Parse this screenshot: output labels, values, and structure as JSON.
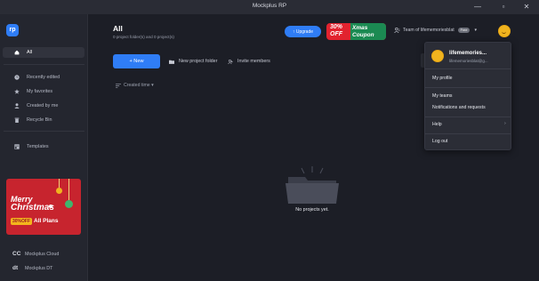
{
  "window": {
    "title": "Mockplus RP",
    "minimize": "—",
    "maximize": "▫",
    "close": "✕"
  },
  "sidebar": {
    "logo": "rp",
    "items": [
      {
        "label": "All",
        "icon": "home-icon",
        "active": true
      },
      {
        "label": "Recently edited",
        "icon": "clock-icon"
      },
      {
        "label": "My favorites",
        "icon": "star-icon"
      },
      {
        "label": "Created by me",
        "icon": "user-icon"
      },
      {
        "label": "Recycle Bin",
        "icon": "trash-icon"
      },
      {
        "label": "Templates",
        "icon": "template-icon"
      }
    ],
    "promo": {
      "line1": "Merry",
      "line2": "Christmas",
      "off": "30%OFF",
      "plans": "All Plans"
    },
    "footer": [
      {
        "mark": "CC",
        "label": "Mockplus Cloud"
      },
      {
        "mark": "dt",
        "label": "Mockplus DT"
      }
    ]
  },
  "header": {
    "title": "All",
    "subtitle": "0 project folder(s) and 0 project(s)",
    "upgrade_label": "↑ Upgrade",
    "coupon": {
      "left": "30%\nOFF",
      "right": "Xmas\nCoupon"
    },
    "team_label": "Team of lifememoriesblat",
    "team_badge": "Free",
    "team_chevron": "▾"
  },
  "toolbar": {
    "new_label": "+  New",
    "new_folder_label": "New project folder",
    "invite_label": "Invite members",
    "sort_label": "Created time ▾"
  },
  "empty_state": {
    "message": "No projects yet."
  },
  "user_menu": {
    "name": "lifememories...",
    "email": "lifememoriesblat@g...",
    "items": [
      "My profile",
      "My teams",
      "Notifications and requests",
      "Help",
      "Log out"
    ],
    "help_arrow": "›"
  },
  "colors": {
    "accent": "#2f7df6",
    "background": "#1c1e26",
    "sidebar": "#24262f",
    "promo_red": "#c7242e",
    "coupon_green": "#1b8a52",
    "avatar": "#f0b41f"
  }
}
